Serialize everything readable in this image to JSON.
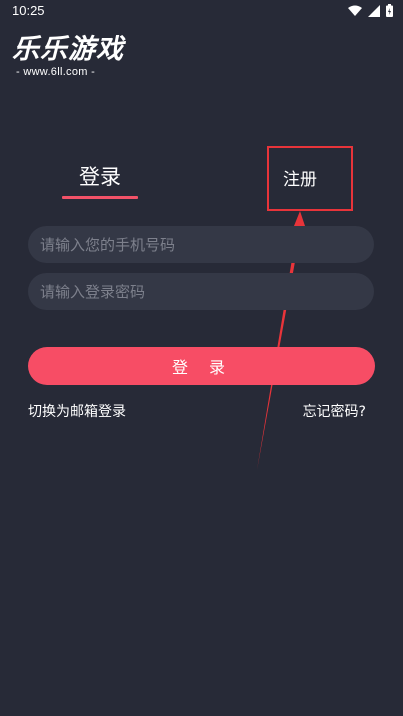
{
  "status_bar": {
    "time": "10:25"
  },
  "logo": {
    "title": "乐乐游戏",
    "url": "- www.6ll.com -"
  },
  "tabs": {
    "login": "登录",
    "register": "注册"
  },
  "form": {
    "phone_placeholder": "请输入您的手机号码",
    "password_placeholder": "请输入登录密码",
    "login_button": "登 录"
  },
  "links": {
    "switch_email": "切换为邮箱登录",
    "forgot_password": "忘记密码?"
  },
  "colors": {
    "background": "#272a37",
    "input_bg": "#343846",
    "accent": "#f74d65",
    "annotation_red": "#e8343a"
  },
  "icons": [
    "wifi-icon",
    "signal-icon",
    "battery-icon"
  ]
}
